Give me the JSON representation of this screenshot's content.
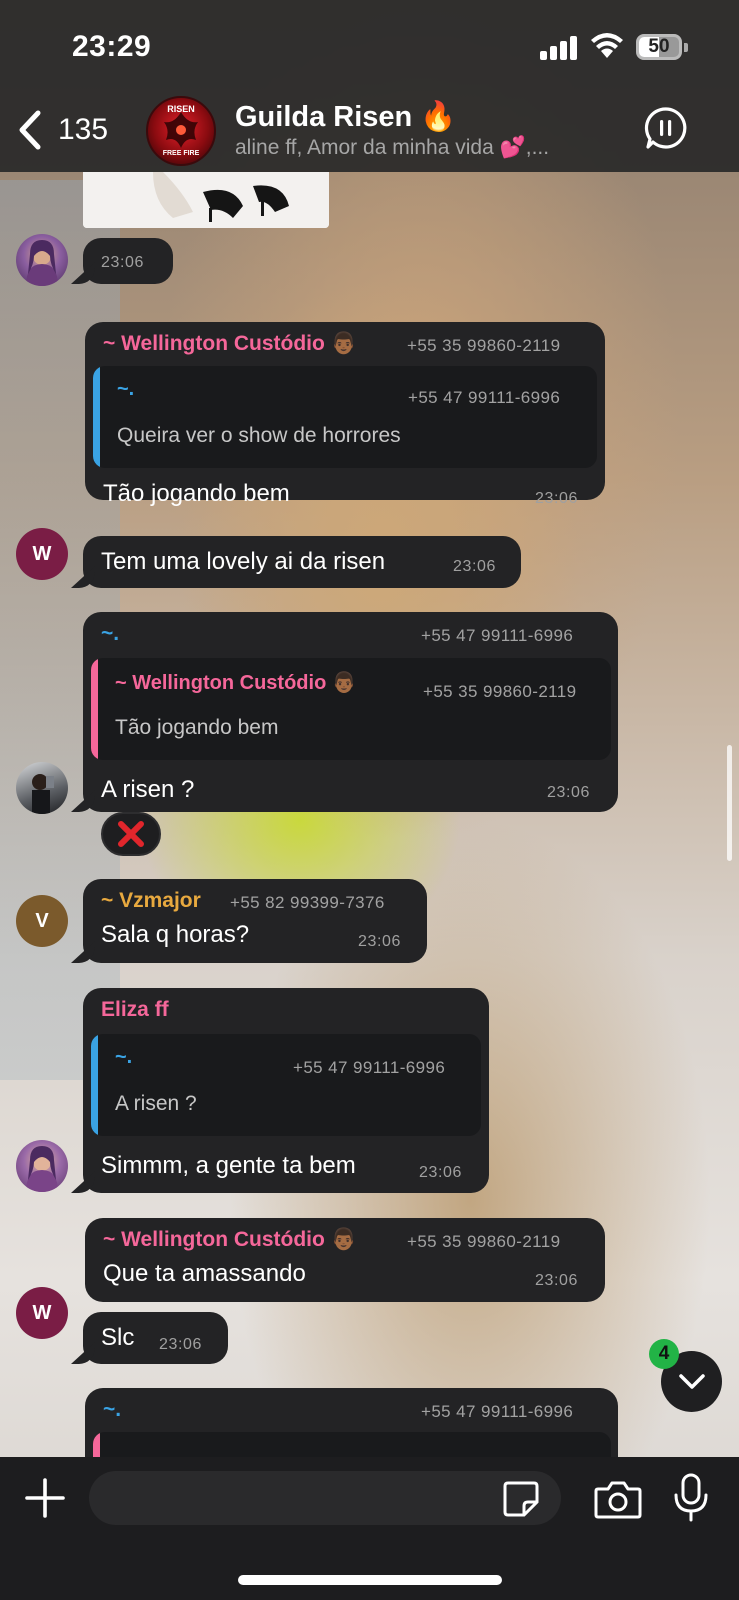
{
  "status": {
    "time": "23:29",
    "battery": "50",
    "battery_fraction": 0.5
  },
  "header": {
    "back_count": "135",
    "group_name": "Guilda Risen 🔥",
    "members_preview": "aline ff, Amor da minha vida 💕,...",
    "avatar_text_top": "RISEN",
    "avatar_text_bottom": "FREE FIRE"
  },
  "messages": [
    {
      "id": "m1",
      "type": "image",
      "time": "23:06"
    },
    {
      "id": "m2",
      "sender": "~ Wellington Custódio 👨🏾",
      "phone": "+55 35 99860-2119",
      "sender_color": "#f5679a",
      "quote": {
        "sender": "~.",
        "phone": "+55 47 99111-6996",
        "text": "Queira ver o show de horrores",
        "bar_color": "#3aa3e4"
      },
      "text": "Tão jogando bem",
      "time": "23:06"
    },
    {
      "id": "m3",
      "avatar_letter": "W",
      "text": "Tem uma lovely ai da risen",
      "time": "23:06"
    },
    {
      "id": "m4",
      "sender": "~.",
      "phone": "+55 47 99111-6996",
      "sender_color": "#3aa3e4",
      "quote": {
        "sender": "~ Wellington Custódio 👨🏾",
        "phone": "+55 35 99860-2119",
        "text": "Tão jogando bem",
        "bar_color": "#f5679a"
      },
      "text": "A risen ?",
      "time": "23:06",
      "reaction": "❌"
    },
    {
      "id": "m5",
      "sender": "~ Vzmajor",
      "phone": "+55 82 99399-7376",
      "sender_color": "#e8a93f",
      "avatar_letter": "V",
      "text": "Sala q horas?",
      "time": "23:06"
    },
    {
      "id": "m6",
      "sender": "Eliza ff",
      "sender_color": "#f5679a",
      "quote": {
        "sender": "~.",
        "phone": "+55 47 99111-6996",
        "text": "A risen ?",
        "bar_color": "#3aa3e4"
      },
      "text": "Simmm, a gente ta bem",
      "time": "23:06"
    },
    {
      "id": "m7",
      "sender": "~ Wellington Custódio 👨🏾",
      "phone": "+55 35 99860-2119",
      "sender_color": "#f5679a",
      "text": "Que ta amassando",
      "time": "23:06"
    },
    {
      "id": "m8",
      "avatar_letter": "W",
      "text": "Slc",
      "time": "23:06"
    },
    {
      "id": "m9",
      "sender": "~.",
      "phone": "+55 47 99111-6996",
      "sender_color": "#3aa3e4"
    }
  ],
  "scroll_down": {
    "unread_count": "4"
  },
  "input": {
    "placeholder": ""
  },
  "colors": {
    "bubble": "#232325",
    "header_bg": "#282828",
    "input_bar": "#1d1d1f",
    "badge_green": "#22b346"
  }
}
